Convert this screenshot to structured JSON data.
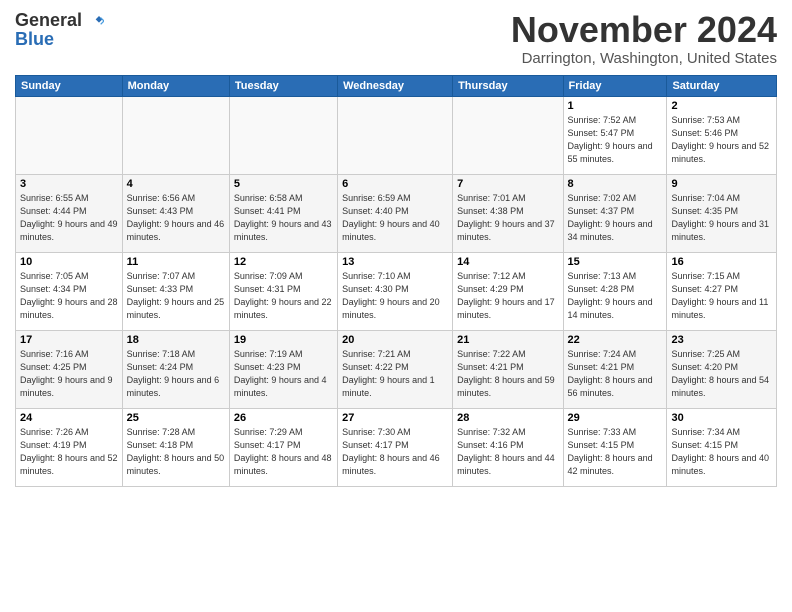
{
  "logo": {
    "general": "General",
    "blue": "Blue"
  },
  "title": "November 2024",
  "location": "Darrington, Washington, United States",
  "headers": [
    "Sunday",
    "Monday",
    "Tuesday",
    "Wednesday",
    "Thursday",
    "Friday",
    "Saturday"
  ],
  "weeks": [
    [
      {
        "day": "",
        "sunrise": "",
        "sunset": "",
        "daylight": ""
      },
      {
        "day": "",
        "sunrise": "",
        "sunset": "",
        "daylight": ""
      },
      {
        "day": "",
        "sunrise": "",
        "sunset": "",
        "daylight": ""
      },
      {
        "day": "",
        "sunrise": "",
        "sunset": "",
        "daylight": ""
      },
      {
        "day": "",
        "sunrise": "",
        "sunset": "",
        "daylight": ""
      },
      {
        "day": "1",
        "sunrise": "Sunrise: 7:52 AM",
        "sunset": "Sunset: 5:47 PM",
        "daylight": "Daylight: 9 hours and 55 minutes."
      },
      {
        "day": "2",
        "sunrise": "Sunrise: 7:53 AM",
        "sunset": "Sunset: 5:46 PM",
        "daylight": "Daylight: 9 hours and 52 minutes."
      }
    ],
    [
      {
        "day": "3",
        "sunrise": "Sunrise: 6:55 AM",
        "sunset": "Sunset: 4:44 PM",
        "daylight": "Daylight: 9 hours and 49 minutes."
      },
      {
        "day": "4",
        "sunrise": "Sunrise: 6:56 AM",
        "sunset": "Sunset: 4:43 PM",
        "daylight": "Daylight: 9 hours and 46 minutes."
      },
      {
        "day": "5",
        "sunrise": "Sunrise: 6:58 AM",
        "sunset": "Sunset: 4:41 PM",
        "daylight": "Daylight: 9 hours and 43 minutes."
      },
      {
        "day": "6",
        "sunrise": "Sunrise: 6:59 AM",
        "sunset": "Sunset: 4:40 PM",
        "daylight": "Daylight: 9 hours and 40 minutes."
      },
      {
        "day": "7",
        "sunrise": "Sunrise: 7:01 AM",
        "sunset": "Sunset: 4:38 PM",
        "daylight": "Daylight: 9 hours and 37 minutes."
      },
      {
        "day": "8",
        "sunrise": "Sunrise: 7:02 AM",
        "sunset": "Sunset: 4:37 PM",
        "daylight": "Daylight: 9 hours and 34 minutes."
      },
      {
        "day": "9",
        "sunrise": "Sunrise: 7:04 AM",
        "sunset": "Sunset: 4:35 PM",
        "daylight": "Daylight: 9 hours and 31 minutes."
      }
    ],
    [
      {
        "day": "10",
        "sunrise": "Sunrise: 7:05 AM",
        "sunset": "Sunset: 4:34 PM",
        "daylight": "Daylight: 9 hours and 28 minutes."
      },
      {
        "day": "11",
        "sunrise": "Sunrise: 7:07 AM",
        "sunset": "Sunset: 4:33 PM",
        "daylight": "Daylight: 9 hours and 25 minutes."
      },
      {
        "day": "12",
        "sunrise": "Sunrise: 7:09 AM",
        "sunset": "Sunset: 4:31 PM",
        "daylight": "Daylight: 9 hours and 22 minutes."
      },
      {
        "day": "13",
        "sunrise": "Sunrise: 7:10 AM",
        "sunset": "Sunset: 4:30 PM",
        "daylight": "Daylight: 9 hours and 20 minutes."
      },
      {
        "day": "14",
        "sunrise": "Sunrise: 7:12 AM",
        "sunset": "Sunset: 4:29 PM",
        "daylight": "Daylight: 9 hours and 17 minutes."
      },
      {
        "day": "15",
        "sunrise": "Sunrise: 7:13 AM",
        "sunset": "Sunset: 4:28 PM",
        "daylight": "Daylight: 9 hours and 14 minutes."
      },
      {
        "day": "16",
        "sunrise": "Sunrise: 7:15 AM",
        "sunset": "Sunset: 4:27 PM",
        "daylight": "Daylight: 9 hours and 11 minutes."
      }
    ],
    [
      {
        "day": "17",
        "sunrise": "Sunrise: 7:16 AM",
        "sunset": "Sunset: 4:25 PM",
        "daylight": "Daylight: 9 hours and 9 minutes."
      },
      {
        "day": "18",
        "sunrise": "Sunrise: 7:18 AM",
        "sunset": "Sunset: 4:24 PM",
        "daylight": "Daylight: 9 hours and 6 minutes."
      },
      {
        "day": "19",
        "sunrise": "Sunrise: 7:19 AM",
        "sunset": "Sunset: 4:23 PM",
        "daylight": "Daylight: 9 hours and 4 minutes."
      },
      {
        "day": "20",
        "sunrise": "Sunrise: 7:21 AM",
        "sunset": "Sunset: 4:22 PM",
        "daylight": "Daylight: 9 hours and 1 minute."
      },
      {
        "day": "21",
        "sunrise": "Sunrise: 7:22 AM",
        "sunset": "Sunset: 4:21 PM",
        "daylight": "Daylight: 8 hours and 59 minutes."
      },
      {
        "day": "22",
        "sunrise": "Sunrise: 7:24 AM",
        "sunset": "Sunset: 4:21 PM",
        "daylight": "Daylight: 8 hours and 56 minutes."
      },
      {
        "day": "23",
        "sunrise": "Sunrise: 7:25 AM",
        "sunset": "Sunset: 4:20 PM",
        "daylight": "Daylight: 8 hours and 54 minutes."
      }
    ],
    [
      {
        "day": "24",
        "sunrise": "Sunrise: 7:26 AM",
        "sunset": "Sunset: 4:19 PM",
        "daylight": "Daylight: 8 hours and 52 minutes."
      },
      {
        "day": "25",
        "sunrise": "Sunrise: 7:28 AM",
        "sunset": "Sunset: 4:18 PM",
        "daylight": "Daylight: 8 hours and 50 minutes."
      },
      {
        "day": "26",
        "sunrise": "Sunrise: 7:29 AM",
        "sunset": "Sunset: 4:17 PM",
        "daylight": "Daylight: 8 hours and 48 minutes."
      },
      {
        "day": "27",
        "sunrise": "Sunrise: 7:30 AM",
        "sunset": "Sunset: 4:17 PM",
        "daylight": "Daylight: 8 hours and 46 minutes."
      },
      {
        "day": "28",
        "sunrise": "Sunrise: 7:32 AM",
        "sunset": "Sunset: 4:16 PM",
        "daylight": "Daylight: 8 hours and 44 minutes."
      },
      {
        "day": "29",
        "sunrise": "Sunrise: 7:33 AM",
        "sunset": "Sunset: 4:15 PM",
        "daylight": "Daylight: 8 hours and 42 minutes."
      },
      {
        "day": "30",
        "sunrise": "Sunrise: 7:34 AM",
        "sunset": "Sunset: 4:15 PM",
        "daylight": "Daylight: 8 hours and 40 minutes."
      }
    ]
  ]
}
